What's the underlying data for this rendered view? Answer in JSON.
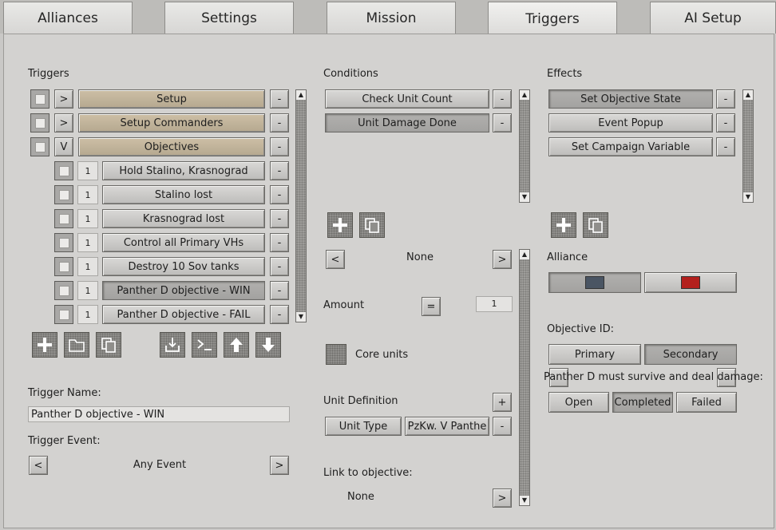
{
  "tabs": [
    {
      "label": "Alliances"
    },
    {
      "label": "Settings"
    },
    {
      "label": "Mission"
    },
    {
      "label": "Triggers"
    },
    {
      "label": "AI Setup"
    }
  ],
  "triggers_panel": {
    "title": "Triggers",
    "folders": [
      {
        "toggle": ">",
        "label": "Setup"
      },
      {
        "toggle": ">",
        "label": "Setup Commanders"
      },
      {
        "toggle": "V",
        "label": "Objectives"
      }
    ],
    "items": [
      {
        "num": "1",
        "label": "Hold Stalino, Krasnograd"
      },
      {
        "num": "1",
        "label": "Stalino lost"
      },
      {
        "num": "1",
        "label": "Krasnograd lost"
      },
      {
        "num": "1",
        "label": "Control all Primary VHs"
      },
      {
        "num": "1",
        "label": "Destroy 10 Sov tanks"
      },
      {
        "num": "1",
        "label": "Panther D  objective - WIN"
      },
      {
        "num": "1",
        "label": "Panther D  objective - FAIL"
      }
    ],
    "remove_label": "-",
    "trigger_name_label": "Trigger Name:",
    "trigger_name_value": "Panther D  objective - WIN",
    "trigger_event_label": "Trigger Event:",
    "trigger_event_value": "Any Event",
    "prev_label": "<",
    "next_label": ">"
  },
  "conditions_panel": {
    "title": "Conditions",
    "items": [
      {
        "label": "Check Unit Count"
      },
      {
        "label": "Unit Damage Done"
      }
    ],
    "remove_label": "-",
    "selector_value": "None",
    "prev_label": "<",
    "next_label": ">",
    "amount_label": "Amount",
    "amount_operator": "=",
    "amount_value": "1",
    "core_units_label": "Core units",
    "unit_definition_label": "Unit Definition",
    "unit_def_add": "+",
    "unit_type_label": "Unit Type",
    "unit_type_value": "PzKw. V Panthe",
    "link_objective_label": "Link to objective:",
    "link_objective_value": "None"
  },
  "effects_panel": {
    "title": "Effects",
    "items": [
      {
        "label": "Set Objective State"
      },
      {
        "label": "Event Popup"
      },
      {
        "label": "Set Campaign Variable"
      }
    ],
    "remove_label": "-",
    "alliance_label": "Alliance",
    "alliance_colors": [
      "#4a5563",
      "#b3201d"
    ],
    "objective_id_label": "Objective ID:",
    "primary_label": "Primary",
    "secondary_label": "Secondary",
    "objective_text": "Panther D must survive and deal damage:",
    "state_open": "Open",
    "state_completed": "Completed",
    "state_failed": "Failed"
  }
}
